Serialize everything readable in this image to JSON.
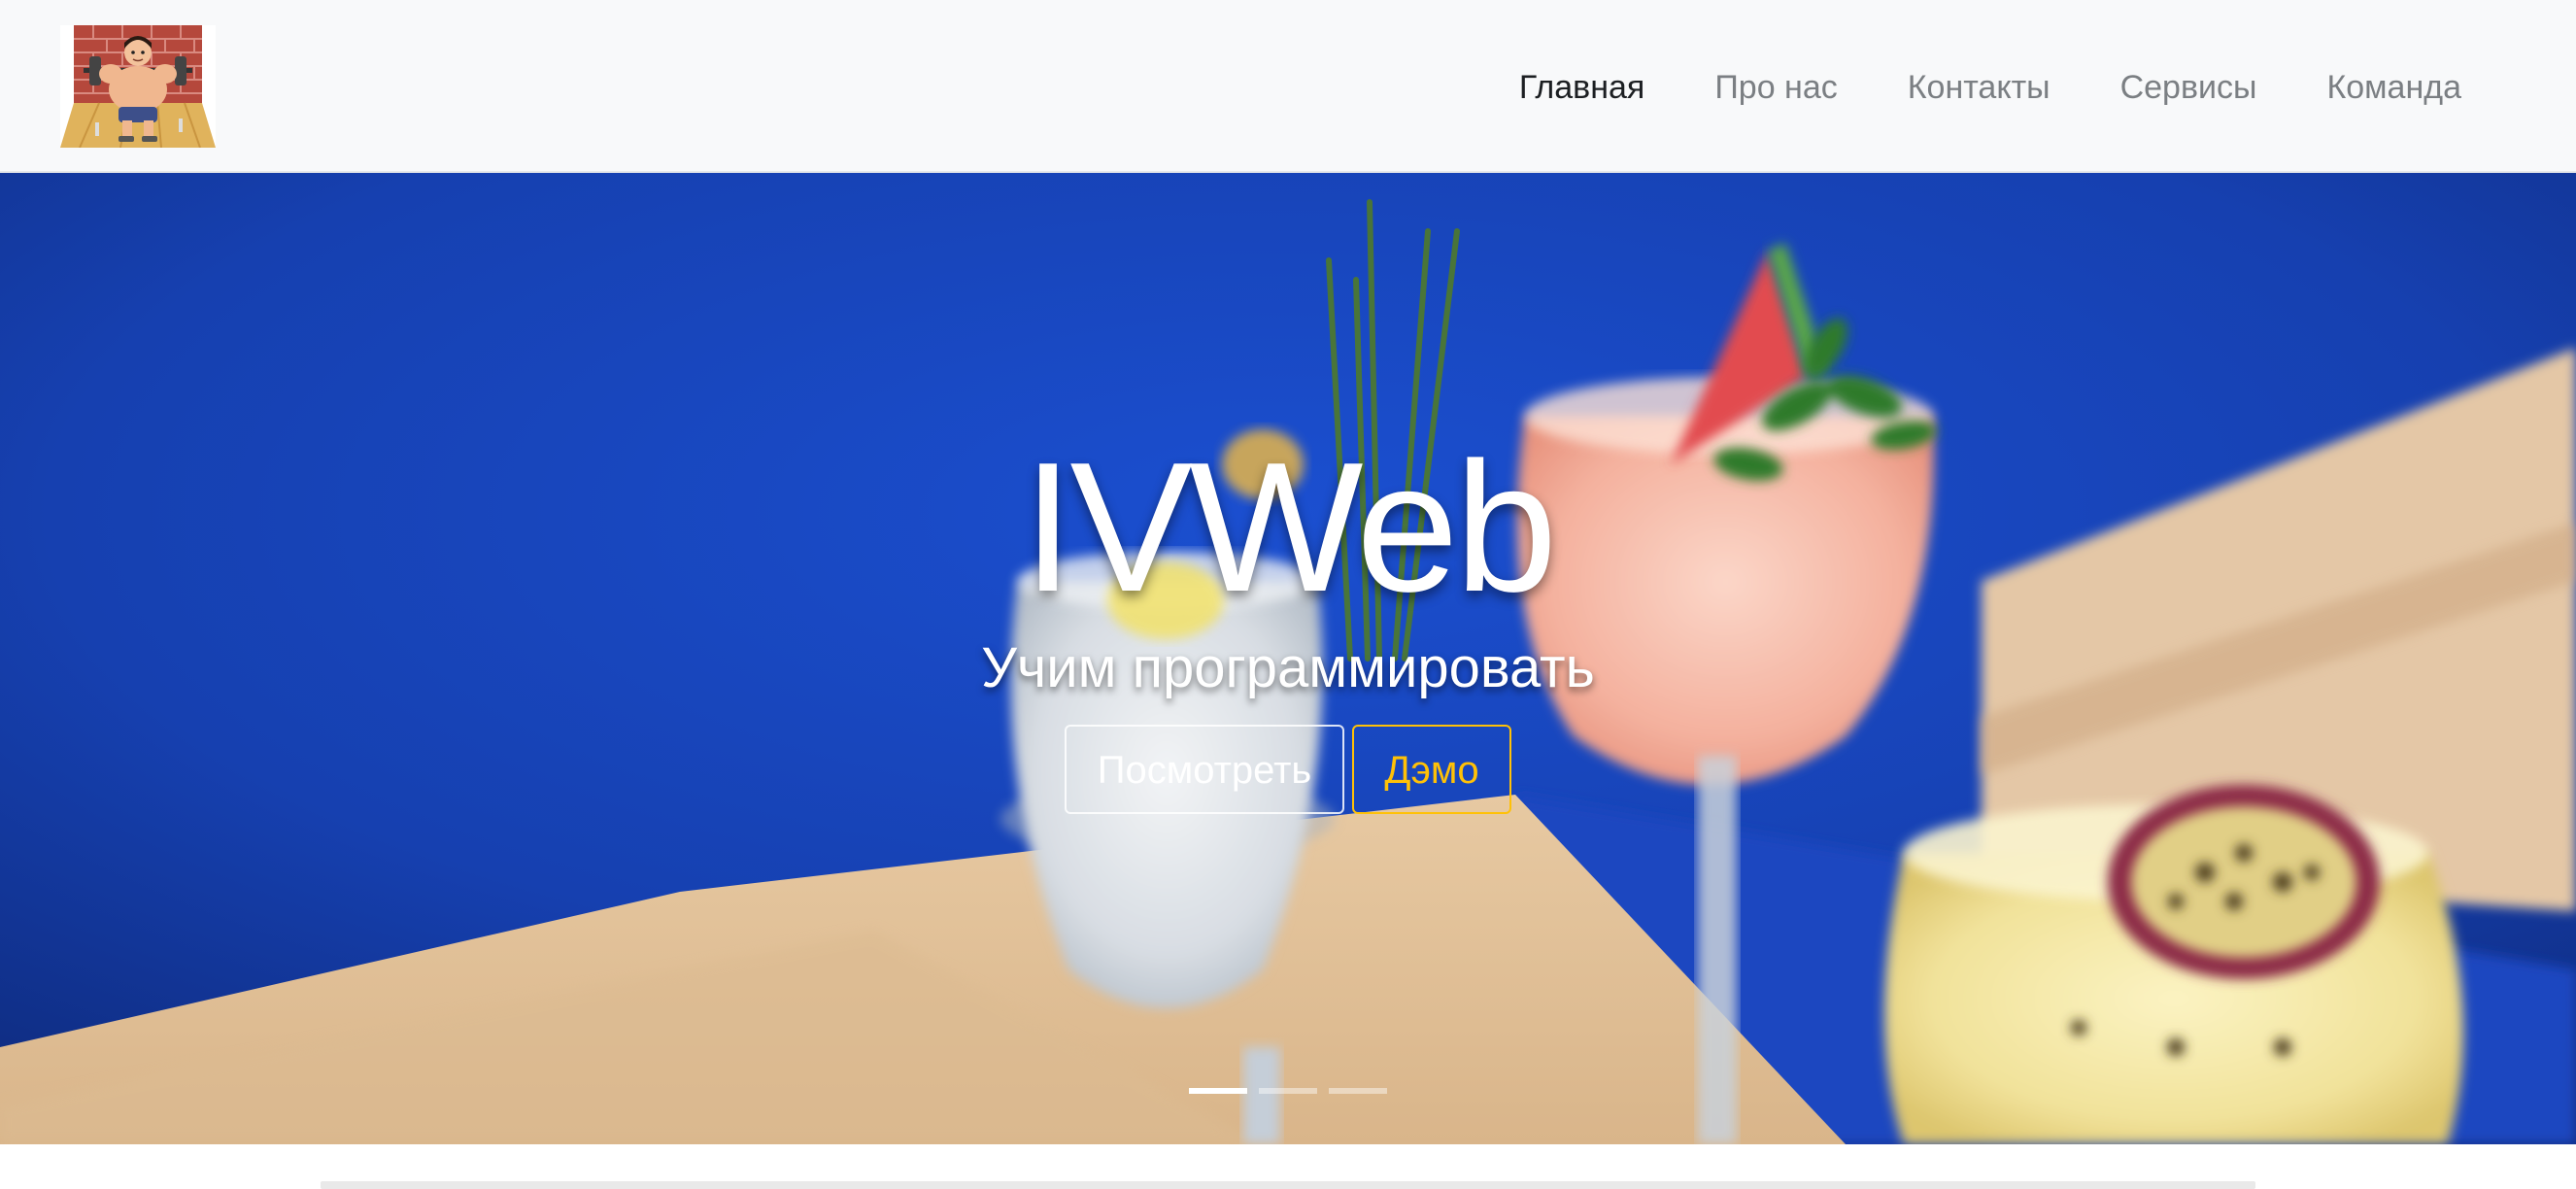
{
  "navbar": {
    "logo": {
      "icon": "cartoon-bodybuilder-logo-icon"
    },
    "links": [
      {
        "label": "Главная",
        "active": true
      },
      {
        "label": "Про нас",
        "active": false
      },
      {
        "label": "Контакты",
        "active": false
      },
      {
        "label": "Сервисы",
        "active": false
      },
      {
        "label": "Команда",
        "active": false
      }
    ]
  },
  "hero": {
    "title": "IVWeb",
    "subtitle": "Учим программировать",
    "buttons": {
      "view_label": "Посмотреть",
      "demo_label": "Дэмо"
    },
    "background": "cocktails-photo",
    "slides_total": 3,
    "active_slide": 1
  },
  "colors": {
    "navbar_bg": "#f8f9fa",
    "nav_active": "#1c1f22",
    "nav_inactive": "#7b7f83",
    "hero_blue": "#1640b0",
    "warning": "#ffc107"
  }
}
